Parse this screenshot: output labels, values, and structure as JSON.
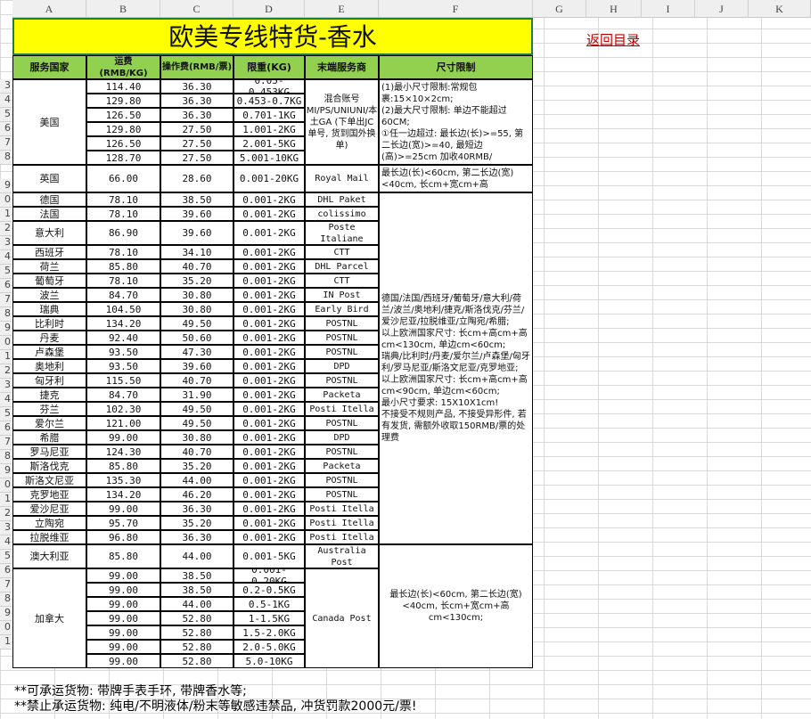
{
  "title": "欧美专线特货-香水",
  "return_link": "返回目录",
  "col_letters": [
    "A",
    "B",
    "C",
    "D",
    "E",
    "F",
    "G",
    "H",
    "I",
    "J",
    "K"
  ],
  "headers": {
    "country": "服务国家",
    "freight": "运费\n(RMB/KG)",
    "handling": "操作费(RMB/票)",
    "weight": "限重(KG)",
    "carrier": "末端服务商",
    "size": "尺寸限制"
  },
  "row_numbers": [
    "3",
    "4",
    "5",
    "6",
    "7",
    "8",
    "9",
    "0",
    "1",
    "2",
    "3",
    "4",
    "5",
    "6",
    "7",
    "8",
    "9",
    "0",
    "1",
    "2",
    "3",
    "4",
    "5",
    "6",
    "7",
    "8",
    "9",
    "0",
    "1",
    "2",
    "3",
    "4",
    "5",
    "6",
    "7",
    "8",
    "9",
    "0",
    "1"
  ],
  "groups": {
    "us_country": "美国",
    "uk_country": "英国",
    "au_country": "澳大利亚",
    "ca_country": "加拿大",
    "us_carrier": "混合账号\nMI/PS/UNIUNI/本土GA (下单出JC单号, 货到国外换单)",
    "us_size": "(1)最小尺寸限制:常规包裹:15×10×2cm;\n(2)最大尺寸限制: 单边不能超过60CM;\n   ①任一边超过: 最长边(长)>=55, 第二长边(宽)>=40, 最短边(高)>=25cm 加收40RMB/",
    "uk_size": "最长边(长)<60cm, 第二长边(宽)<40cm, 长cm+宽cm+高",
    "eu_size": "德国/法国/西班牙/葡萄牙/意大利/荷兰/波兰/奥地利/捷克/斯洛伐克/芬兰/爱沙尼亚/拉脱维亚/立陶宛/希腊;\n以上欧洲国家尺寸: 长cm+高cm+高cm<130cm, 单边cm<60cm;\n瑞典/比利时/丹麦/爱尔兰/卢森堡/匈牙利/罗马尼亚/斯洛文尼亚/克罗地亚;\n以上欧洲国家尺寸: 长cm+高cm+高cm<90cm, 单边cm<60cm;\n最小尺寸要求: 15X10X1cm!\n不接受不规则产品, 不接受异形件, 若有发货, 需额外收取150RMB/票的处理费",
    "au_carrier": "Australia Post",
    "ca_carrier": "Canada Post",
    "ca_size": "最长边(长)<60cm, 第二长边(宽)<40cm, 长cm+宽cm+高cm<130cm;"
  },
  "us_rows": [
    {
      "freight": "114.40",
      "handling": "36.30",
      "weight": "0.05-0.453KG"
    },
    {
      "freight": "129.80",
      "handling": "36.30",
      "weight": "0.453-0.7KG"
    },
    {
      "freight": "126.50",
      "handling": "36.30",
      "weight": "0.701-1KG"
    },
    {
      "freight": "129.80",
      "handling": "27.50",
      "weight": "1.001-2KG"
    },
    {
      "freight": "126.50",
      "handling": "27.50",
      "weight": "2.001-5KG"
    },
    {
      "freight": "128.70",
      "handling": "27.50",
      "weight": "5.001-10KG"
    }
  ],
  "uk_row": {
    "freight": "66.00",
    "handling": "28.60",
    "weight": "0.001-20KG",
    "carrier": "Royal Mail"
  },
  "eu_rows": [
    {
      "country": "德国",
      "freight": "78.10",
      "handling": "38.50",
      "weight": "0.001-2KG",
      "carrier": "DHL Paket"
    },
    {
      "country": "法国",
      "freight": "78.10",
      "handling": "39.60",
      "weight": "0.001-2KG",
      "carrier": "colissimo"
    },
    {
      "country": "意大利",
      "freight": "86.90",
      "handling": "39.60",
      "weight": "0.001-2KG",
      "carrier": "Poste Italiane"
    },
    {
      "country": "西班牙",
      "freight": "78.10",
      "handling": "34.10",
      "weight": "0.001-2KG",
      "carrier": "CTT"
    },
    {
      "country": "荷兰",
      "freight": "85.80",
      "handling": "40.70",
      "weight": "0.001-2KG",
      "carrier": "DHL Parcel"
    },
    {
      "country": "葡萄牙",
      "freight": "78.10",
      "handling": "35.20",
      "weight": "0.001-2KG",
      "carrier": "CTT"
    },
    {
      "country": "波兰",
      "freight": "84.70",
      "handling": "30.80",
      "weight": "0.001-2KG",
      "carrier": "IN Post"
    },
    {
      "country": "瑞典",
      "freight": "104.50",
      "handling": "30.80",
      "weight": "0.001-2KG",
      "carrier": "Early Bird"
    },
    {
      "country": "比利时",
      "freight": "134.20",
      "handling": "49.50",
      "weight": "0.001-2KG",
      "carrier": "POSTNL"
    },
    {
      "country": "丹麦",
      "freight": "92.40",
      "handling": "50.60",
      "weight": "0.001-2KG",
      "carrier": "POSTNL"
    },
    {
      "country": "卢森堡",
      "freight": "93.50",
      "handling": "47.30",
      "weight": "0.001-2KG",
      "carrier": "POSTNL"
    },
    {
      "country": "奥地利",
      "freight": "93.50",
      "handling": "39.60",
      "weight": "0.001-2KG",
      "carrier": "DPD"
    },
    {
      "country": "匈牙利",
      "freight": "115.50",
      "handling": "40.70",
      "weight": "0.001-2KG",
      "carrier": "POSTNL"
    },
    {
      "country": "捷克",
      "freight": "84.70",
      "handling": "31.90",
      "weight": "0.001-2KG",
      "carrier": "Packeta"
    },
    {
      "country": "芬兰",
      "freight": "102.30",
      "handling": "49.50",
      "weight": "0.001-2KG",
      "carrier": "Posti Itella"
    },
    {
      "country": "爱尔兰",
      "freight": "121.00",
      "handling": "49.50",
      "weight": "0.001-2KG",
      "carrier": "POSTNL"
    },
    {
      "country": "希腊",
      "freight": "99.00",
      "handling": "30.80",
      "weight": "0.001-2KG",
      "carrier": "DPD"
    },
    {
      "country": "罗马尼亚",
      "freight": "124.30",
      "handling": "40.70",
      "weight": "0.001-2KG",
      "carrier": "POSTNL"
    },
    {
      "country": "斯洛伐克",
      "freight": "85.80",
      "handling": "35.20",
      "weight": "0.001-2KG",
      "carrier": "Packeta"
    },
    {
      "country": "斯洛文尼亚",
      "freight": "135.30",
      "handling": "44.00",
      "weight": "0.001-2KG",
      "carrier": "POSTNL"
    },
    {
      "country": "克罗地亚",
      "freight": "134.20",
      "handling": "46.20",
      "weight": "0.001-2KG",
      "carrier": "POSTNL"
    },
    {
      "country": "爱沙尼亚",
      "freight": "99.00",
      "handling": "36.30",
      "weight": "0.001-2KG",
      "carrier": "Posti Itella"
    },
    {
      "country": "立陶宛",
      "freight": "95.70",
      "handling": "35.20",
      "weight": "0.001-2KG",
      "carrier": "Posti Itella"
    },
    {
      "country": "拉脱维亚",
      "freight": "96.80",
      "handling": "36.30",
      "weight": "0.001-2KG",
      "carrier": "Posti Itella"
    }
  ],
  "au_row": {
    "freight": "85.80",
    "handling": "44.00",
    "weight": "0.001-5KG"
  },
  "ca_rows": [
    {
      "freight": "99.00",
      "handling": "38.50",
      "weight": "0.001-0.20KG"
    },
    {
      "freight": "99.00",
      "handling": "38.50",
      "weight": "0.2-0.5KG"
    },
    {
      "freight": "99.00",
      "handling": "44.00",
      "weight": "0.5-1KG"
    },
    {
      "freight": "99.00",
      "handling": "52.80",
      "weight": "1-1.5KG"
    },
    {
      "freight": "99.00",
      "handling": "52.80",
      "weight": "1.5-2.0KG"
    },
    {
      "freight": "99.00",
      "handling": "52.80",
      "weight": "2.0-5.0KG"
    },
    {
      "freight": "99.00",
      "handling": "52.80",
      "weight": "5.0-10KG"
    }
  ],
  "footer": {
    "line1": "**可承运货物: 带牌手表手环, 带牌香水等;",
    "line2": "**禁止承运货物: 纯电/不明液体/粉末等敏感违禁品, 冲货罚款2000元/票!"
  }
}
